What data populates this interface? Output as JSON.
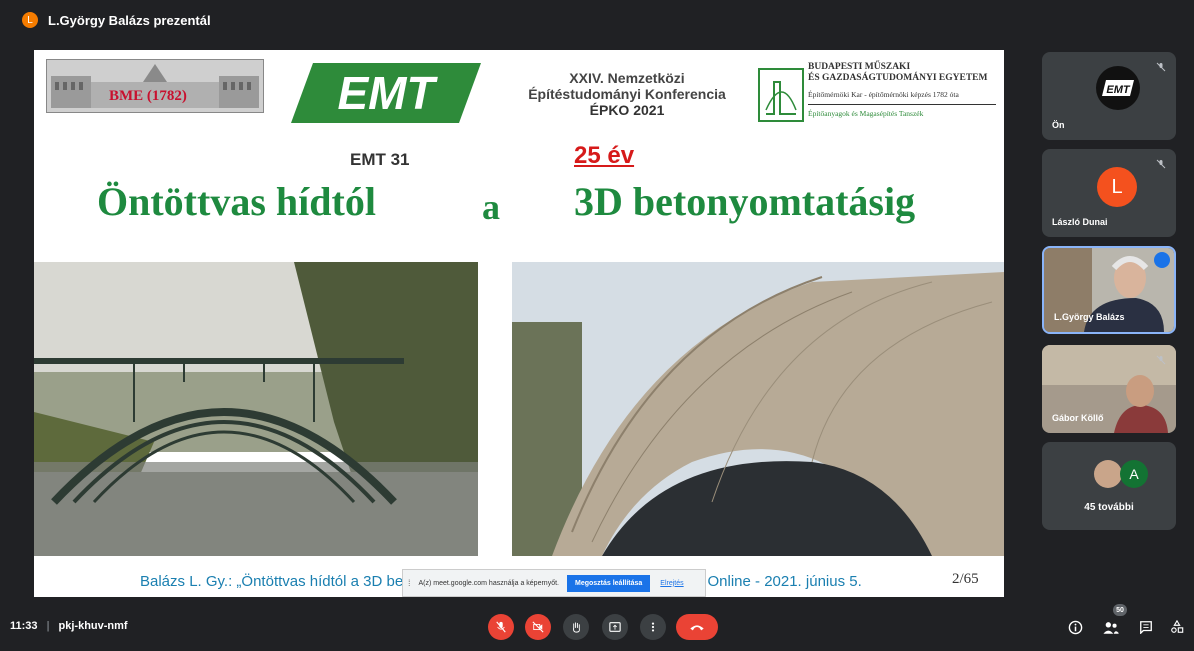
{
  "presenter": {
    "avatar_letter": "L",
    "label": "L.György Balázs prezentál"
  },
  "slide": {
    "bme_logo_text": "BME (1782)",
    "emt_logo_text": "EMT",
    "conference": {
      "line1": "XXIV. Nemzetközi",
      "line2": "Építéstudományi Konferencia",
      "line3": "ÉPKO 2021"
    },
    "university": {
      "name_line1": "BUDAPESTI MŰSZAKI",
      "name_line2": "ÉS GAZDASÁGTUDOMÁNYI EGYETEM",
      "faculty": "Építőmérnöki Kar - építőmérnöki képzés 1782 óta",
      "department": "Építőanyagok és Magasépítés Tanszék"
    },
    "emt31": "EMT 31",
    "years": "25 év",
    "title_left": "Öntöttvas hídtól",
    "title_mid": "a",
    "title_right": "3D betonyomtatásig",
    "caption": "Balázs L. Gy.: „Öntöttvas hídtól a 3D betonnynomtatásig, 25. ÉPKO2021 Csíksomlyó Online - 2021. június 5.",
    "page_number": "2/65"
  },
  "share_bar": {
    "message": "A(z) meet.google.com használja a képernyőt.",
    "stop_label": "Megosztás leállítása",
    "hide_label": "Elrejtés"
  },
  "participants": [
    {
      "name": "Ön",
      "avatar": "EMT",
      "muted": true
    },
    {
      "name": "László Dunai",
      "avatar_letter": "L",
      "muted": true
    },
    {
      "name": "L.György Balázs",
      "speaking": true
    },
    {
      "name": "Gábor Köllő",
      "muted": true
    }
  ],
  "more_participants": {
    "avatar_letter": "A",
    "label": "45 további"
  },
  "bottom": {
    "time": "11:33",
    "separator": "|",
    "meeting_code": "pkj-khuv-nmf",
    "participant_count": "50"
  },
  "colors": {
    "end_call": "#ea4335",
    "title_green": "#1e8a3f",
    "years_red": "#d61a1a",
    "accent_blue": "#1a73e8"
  }
}
